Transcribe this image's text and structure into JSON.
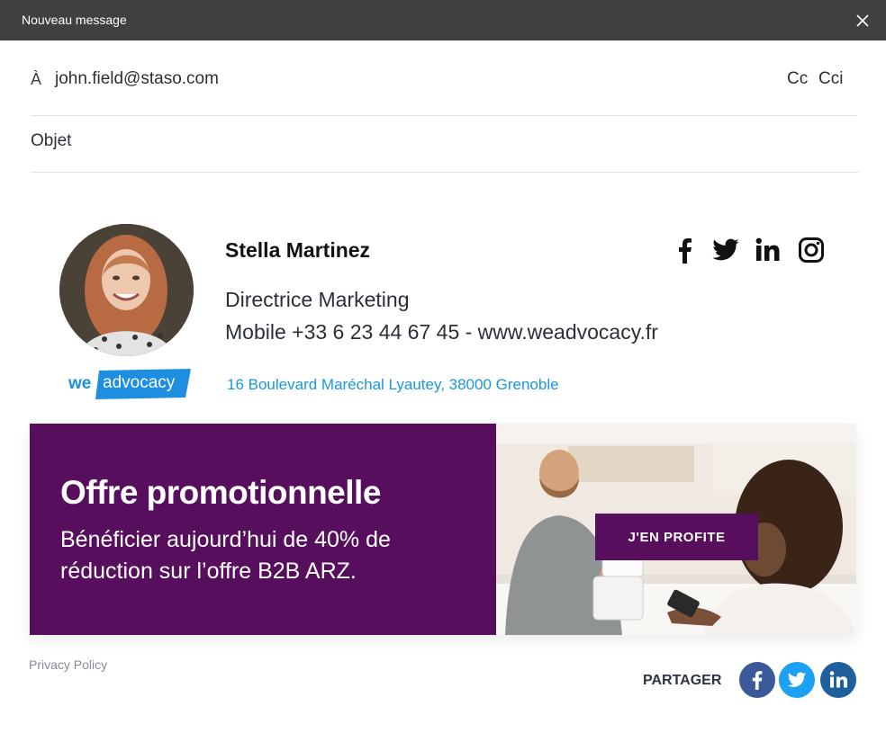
{
  "window": {
    "title": "Nouveau message",
    "close_icon": "close-icon"
  },
  "compose": {
    "to_label": "À",
    "to_value": "john.field@staso.com",
    "cc_label": "Cc",
    "cci_label": "Cci",
    "subject_placeholder": "Objet"
  },
  "signature": {
    "name": "Stella Martinez",
    "role": "Directrice Marketing",
    "contact": "Mobile +33 6 23 44 67 45 - www.weadvocacy.fr",
    "address": "16 Boulevard Maréchal Lyautey, 38000 Grenoble",
    "logo": {
      "part1": "we",
      "part2": "advocacy"
    },
    "social_icons": [
      "facebook-icon",
      "twitter-icon",
      "linkedin-icon",
      "instagram-icon"
    ]
  },
  "banner": {
    "title": "Offre promotionnelle",
    "text": "Bénéficier aujourd’hui de 40% de réduction sur l’offre B2B ARZ.",
    "cta": "J'EN PROFITE"
  },
  "footer": {
    "privacy": "Privacy Policy",
    "share_label": "PARTAGER",
    "share_icons": [
      "facebook-icon",
      "twitter-icon",
      "linkedin-icon"
    ]
  },
  "colors": {
    "titlebar": "#404040",
    "banner_purple": "#570e5c",
    "link_blue": "#1a98de",
    "facebook": "#3b5998",
    "twitter": "#1da1f2",
    "linkedin": "#1f5f9c"
  }
}
